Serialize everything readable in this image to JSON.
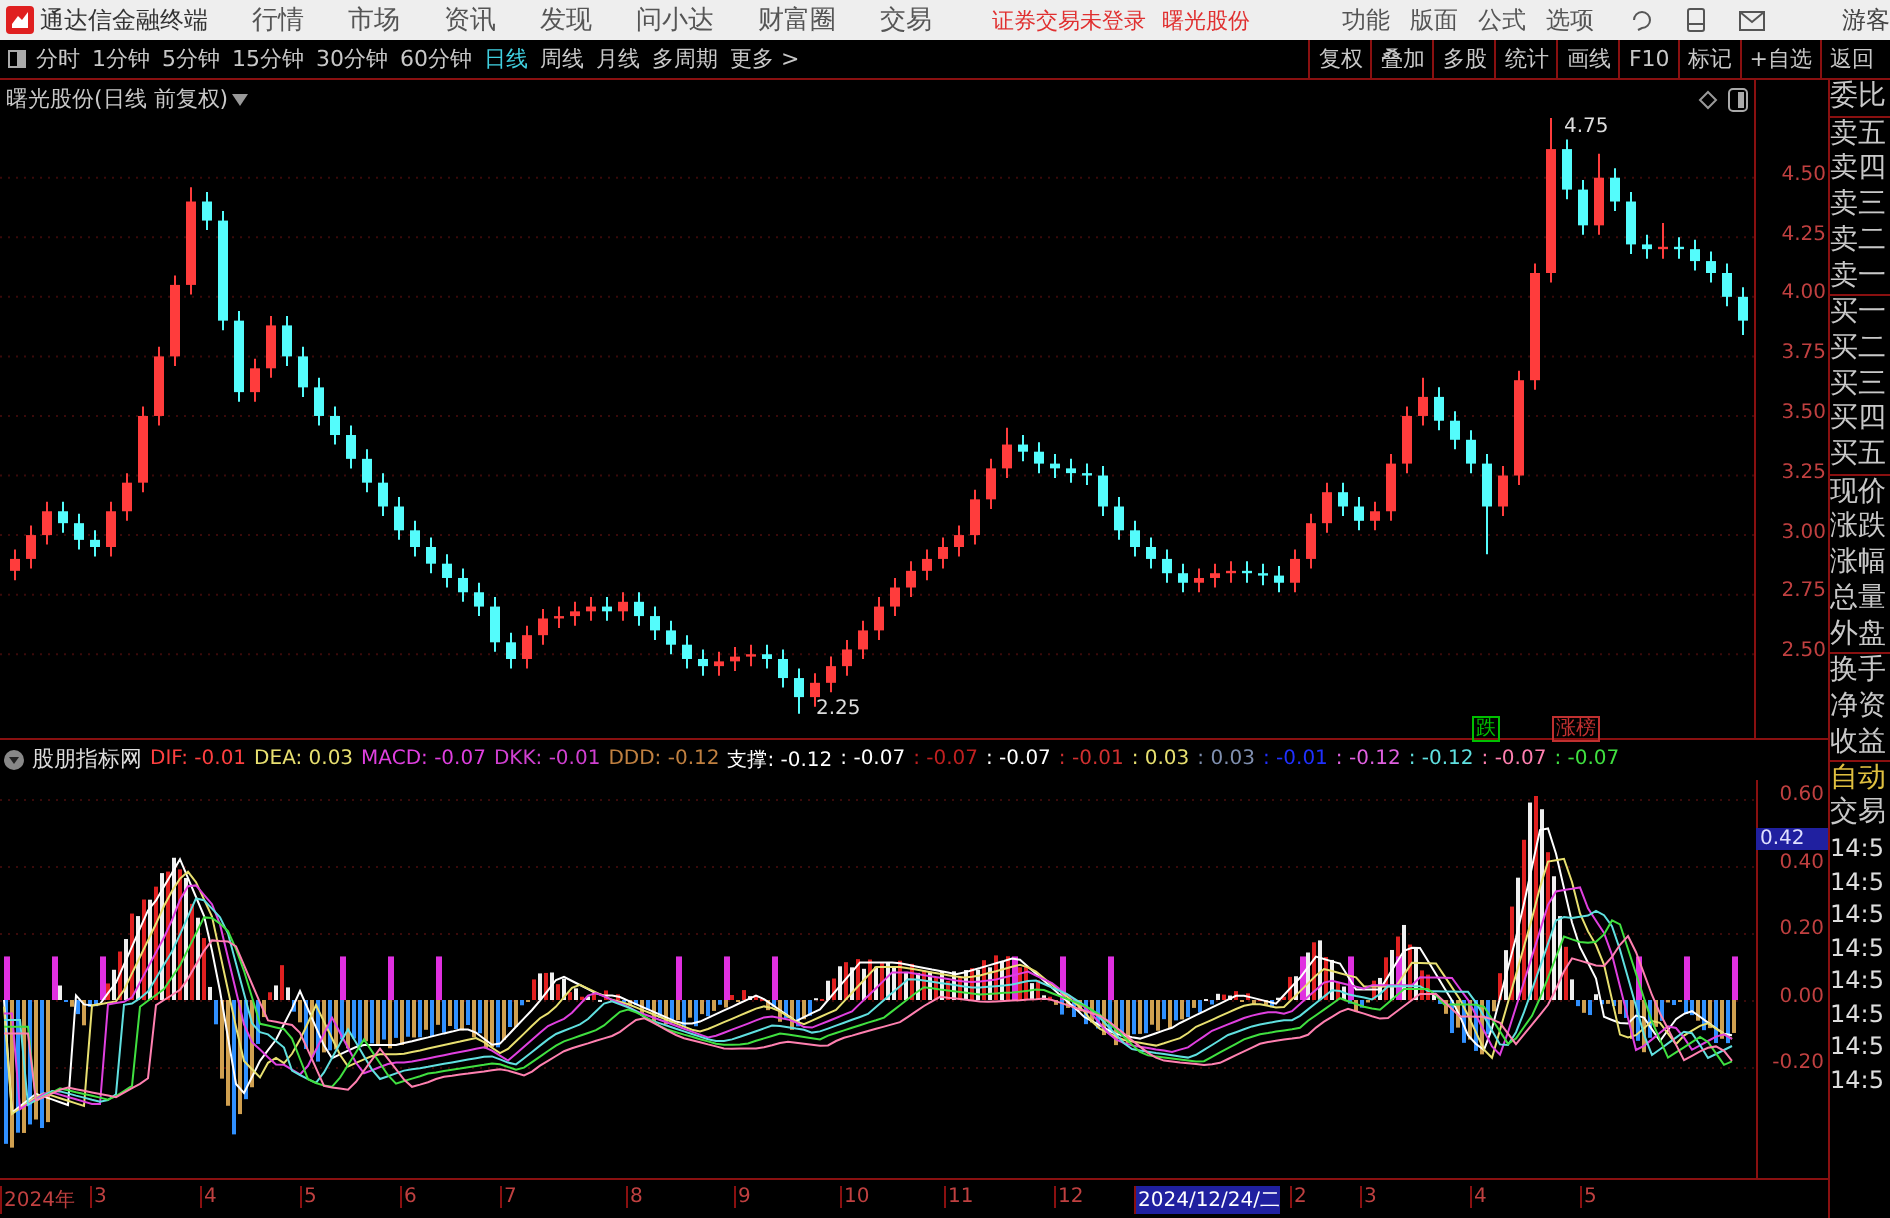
{
  "app": {
    "title": "通达信金融终端",
    "menus": [
      "行情",
      "市场",
      "资讯",
      "发现",
      "问小达",
      "财富圈",
      "交易"
    ],
    "notices": [
      "证券交易未登录",
      "曙光股份"
    ],
    "right_menus": [
      "功能",
      "版面",
      "公式",
      "选项"
    ],
    "user": "游客"
  },
  "periods": [
    {
      "label": "分时",
      "selected": false
    },
    {
      "label": "1分钟",
      "selected": false
    },
    {
      "label": "5分钟",
      "selected": false
    },
    {
      "label": "15分钟",
      "selected": false
    },
    {
      "label": "30分钟",
      "selected": false
    },
    {
      "label": "60分钟",
      "selected": false
    },
    {
      "label": "日线",
      "selected": true
    },
    {
      "label": "周线",
      "selected": false
    },
    {
      "label": "月线",
      "selected": false
    },
    {
      "label": "多周期",
      "selected": false
    },
    {
      "label": "更多 >",
      "selected": false
    }
  ],
  "tools": [
    "复权",
    "叠加",
    "多股",
    "统计",
    "画线",
    "F10",
    "标记",
    "+自选",
    "返回"
  ],
  "price_chart": {
    "title": "曙光股份(日线 前复权)",
    "high_label": "4.75",
    "low_label": "2.25",
    "badges": [
      {
        "text": "跌",
        "color": "#00c000"
      },
      {
        "text": "涨榜",
        "color": "#c03030"
      }
    ],
    "chart_data": {
      "type": "candlestick",
      "ylim": [
        2.14,
        4.91
      ],
      "grid": true,
      "yticks": [
        {
          "value": 4.5,
          "label": "4.50"
        },
        {
          "value": 4.25,
          "label": "4.25"
        },
        {
          "value": 4.0,
          "label": "4.00"
        },
        {
          "value": 3.75,
          "label": "3.75"
        },
        {
          "value": 3.5,
          "label": "3.50"
        },
        {
          "value": 3.25,
          "label": "3.25"
        },
        {
          "value": 3.0,
          "label": "3.00"
        },
        {
          "value": 2.75,
          "label": "2.75"
        },
        {
          "value": 2.5,
          "label": "2.50"
        }
      ],
      "ohlc": [
        [
          2.85,
          2.94,
          2.81,
          2.9
        ],
        [
          2.9,
          3.04,
          2.86,
          3.0
        ],
        [
          3.0,
          3.14,
          2.96,
          3.1
        ],
        [
          3.1,
          3.14,
          3.01,
          3.05
        ],
        [
          3.05,
          3.09,
          2.94,
          2.98
        ],
        [
          2.98,
          3.02,
          2.91,
          2.95
        ],
        [
          2.95,
          3.14,
          2.91,
          3.1
        ],
        [
          3.1,
          3.26,
          3.06,
          3.22
        ],
        [
          3.22,
          3.54,
          3.18,
          3.5
        ],
        [
          3.5,
          3.79,
          3.46,
          3.75
        ],
        [
          3.75,
          4.09,
          3.71,
          4.05
        ],
        [
          4.05,
          4.46,
          4.01,
          4.4
        ],
        [
          4.4,
          4.44,
          4.28,
          4.32
        ],
        [
          4.32,
          4.36,
          3.86,
          3.9
        ],
        [
          3.9,
          3.94,
          3.56,
          3.6
        ],
        [
          3.6,
          3.74,
          3.56,
          3.7
        ],
        [
          3.7,
          3.92,
          3.66,
          3.88
        ],
        [
          3.88,
          3.92,
          3.71,
          3.75
        ],
        [
          3.75,
          3.79,
          3.58,
          3.62
        ],
        [
          3.62,
          3.66,
          3.46,
          3.5
        ],
        [
          3.5,
          3.54,
          3.38,
          3.42
        ],
        [
          3.42,
          3.46,
          3.28,
          3.32
        ],
        [
          3.32,
          3.36,
          3.18,
          3.22
        ],
        [
          3.22,
          3.26,
          3.08,
          3.12
        ],
        [
          3.12,
          3.16,
          2.98,
          3.02
        ],
        [
          3.02,
          3.06,
          2.91,
          2.95
        ],
        [
          2.95,
          2.99,
          2.84,
          2.88
        ],
        [
          2.88,
          2.92,
          2.78,
          2.82
        ],
        [
          2.82,
          2.86,
          2.72,
          2.76
        ],
        [
          2.76,
          2.8,
          2.66,
          2.7
        ],
        [
          2.7,
          2.74,
          2.51,
          2.55
        ],
        [
          2.55,
          2.59,
          2.44,
          2.48
        ],
        [
          2.48,
          2.62,
          2.44,
          2.58
        ],
        [
          2.58,
          2.69,
          2.54,
          2.65
        ],
        [
          2.65,
          2.7,
          2.61,
          2.66
        ],
        [
          2.66,
          2.72,
          2.62,
          2.68
        ],
        [
          2.68,
          2.74,
          2.64,
          2.7
        ],
        [
          2.7,
          2.74,
          2.64,
          2.68
        ],
        [
          2.68,
          2.76,
          2.64,
          2.72
        ],
        [
          2.72,
          2.76,
          2.62,
          2.66
        ],
        [
          2.66,
          2.7,
          2.56,
          2.6
        ],
        [
          2.6,
          2.64,
          2.5,
          2.54
        ],
        [
          2.54,
          2.58,
          2.44,
          2.48
        ],
        [
          2.48,
          2.52,
          2.41,
          2.45
        ],
        [
          2.45,
          2.51,
          2.41,
          2.47
        ],
        [
          2.47,
          2.53,
          2.43,
          2.49
        ],
        [
          2.49,
          2.54,
          2.45,
          2.5
        ],
        [
          2.5,
          2.54,
          2.44,
          2.48
        ],
        [
          2.48,
          2.52,
          2.36,
          2.4
        ],
        [
          2.4,
          2.44,
          2.25,
          2.32
        ],
        [
          2.32,
          2.42,
          2.28,
          2.38
        ],
        [
          2.38,
          2.49,
          2.34,
          2.45
        ],
        [
          2.45,
          2.56,
          2.41,
          2.52
        ],
        [
          2.52,
          2.64,
          2.48,
          2.6
        ],
        [
          2.6,
          2.74,
          2.56,
          2.7
        ],
        [
          2.7,
          2.82,
          2.66,
          2.78
        ],
        [
          2.78,
          2.89,
          2.74,
          2.85
        ],
        [
          2.85,
          2.94,
          2.81,
          2.9
        ],
        [
          2.9,
          2.99,
          2.86,
          2.95
        ],
        [
          2.95,
          3.04,
          2.91,
          3.0
        ],
        [
          3.0,
          3.19,
          2.96,
          3.15
        ],
        [
          3.15,
          3.32,
          3.11,
          3.28
        ],
        [
          3.28,
          3.45,
          3.24,
          3.38
        ],
        [
          3.38,
          3.42,
          3.31,
          3.35
        ],
        [
          3.35,
          3.39,
          3.26,
          3.3
        ],
        [
          3.3,
          3.34,
          3.24,
          3.28
        ],
        [
          3.28,
          3.32,
          3.22,
          3.26
        ],
        [
          3.26,
          3.3,
          3.21,
          3.25
        ],
        [
          3.25,
          3.29,
          3.08,
          3.12
        ],
        [
          3.12,
          3.16,
          2.98,
          3.02
        ],
        [
          3.02,
          3.06,
          2.91,
          2.95
        ],
        [
          2.95,
          2.99,
          2.86,
          2.9
        ],
        [
          2.9,
          2.94,
          2.8,
          2.84
        ],
        [
          2.84,
          2.88,
          2.76,
          2.8
        ],
        [
          2.8,
          2.86,
          2.76,
          2.82
        ],
        [
          2.82,
          2.88,
          2.78,
          2.84
        ],
        [
          2.84,
          2.89,
          2.8,
          2.85
        ],
        [
          2.85,
          2.89,
          2.8,
          2.84
        ],
        [
          2.84,
          2.88,
          2.79,
          2.83
        ],
        [
          2.83,
          2.87,
          2.76,
          2.8
        ],
        [
          2.8,
          2.94,
          2.76,
          2.9
        ],
        [
          2.9,
          3.09,
          2.86,
          3.05
        ],
        [
          3.05,
          3.22,
          3.01,
          3.18
        ],
        [
          3.18,
          3.22,
          3.08,
          3.12
        ],
        [
          3.12,
          3.16,
          3.02,
          3.06
        ],
        [
          3.06,
          3.14,
          3.02,
          3.1
        ],
        [
          3.1,
          3.34,
          3.06,
          3.3
        ],
        [
          3.3,
          3.54,
          3.26,
          3.5
        ],
        [
          3.5,
          3.66,
          3.46,
          3.58
        ],
        [
          3.58,
          3.62,
          3.44,
          3.48
        ],
        [
          3.48,
          3.52,
          3.36,
          3.4
        ],
        [
          3.4,
          3.44,
          3.26,
          3.3
        ],
        [
          3.3,
          3.34,
          2.92,
          3.12
        ],
        [
          3.12,
          3.29,
          3.08,
          3.25
        ],
        [
          3.25,
          3.69,
          3.21,
          3.65
        ],
        [
          3.65,
          4.14,
          3.61,
          4.1
        ],
        [
          4.1,
          4.75,
          4.06,
          4.62
        ],
        [
          4.62,
          4.66,
          4.41,
          4.45
        ],
        [
          4.45,
          4.49,
          4.26,
          4.3
        ],
        [
          4.3,
          4.6,
          4.26,
          4.5
        ],
        [
          4.5,
          4.54,
          4.36,
          4.4
        ],
        [
          4.4,
          4.44,
          4.18,
          4.22
        ],
        [
          4.22,
          4.26,
          4.16,
          4.2
        ],
        [
          4.2,
          4.31,
          4.16,
          4.21
        ],
        [
          4.21,
          4.25,
          4.16,
          4.2
        ],
        [
          4.2,
          4.24,
          4.11,
          4.15
        ],
        [
          4.15,
          4.19,
          4.06,
          4.1
        ],
        [
          4.1,
          4.14,
          3.96,
          4.0
        ],
        [
          4.0,
          4.04,
          3.84,
          3.9
        ]
      ]
    }
  },
  "indicator": {
    "name": "股朋指标网",
    "values": [
      {
        "text": "DIF: -0.01",
        "color": "#ff4040"
      },
      {
        "text": "DEA: 0.03",
        "color": "#e8e070"
      },
      {
        "text": "MACD: -0.07",
        "color": "#e040e0"
      },
      {
        "text": "DKK: -0.01",
        "color": "#d040d0"
      },
      {
        "text": "DDD: -0.12",
        "color": "#c08040"
      },
      {
        "text": "支撑: -0.12",
        "color": "#ffffff"
      },
      {
        "text": ": -0.07",
        "color": "#ffffff"
      },
      {
        "text": ": -0.07",
        "color": "#c02020"
      },
      {
        "text": ": -0.07",
        "color": "#ffffff"
      },
      {
        "text": ": -0.01",
        "color": "#d03030"
      },
      {
        "text": ": 0.03",
        "color": "#e8e070"
      },
      {
        "text": ": 0.03",
        "color": "#8090b0"
      },
      {
        "text": ": -0.01",
        "color": "#2030ff"
      },
      {
        "text": ": -0.12",
        "color": "#e060e0"
      },
      {
        "text": ": -0.12",
        "color": "#60e0e0"
      },
      {
        "text": ": -0.07",
        "color": "#ff80b0"
      },
      {
        "text": ": -0.07",
        "color": "#40e040"
      }
    ],
    "yticks": [
      "0.60",
      "0.40",
      "0.20",
      "0.00",
      "-0.20"
    ],
    "cursor_value": "0.42"
  },
  "date_axis": [
    {
      "label": "2024年",
      "highlighted": false
    },
    {
      "label": "3",
      "highlighted": false
    },
    {
      "label": "4",
      "highlighted": false
    },
    {
      "label": "5",
      "highlighted": false
    },
    {
      "label": "6",
      "highlighted": false
    },
    {
      "label": "7",
      "highlighted": false
    },
    {
      "label": "8",
      "highlighted": false
    },
    {
      "label": "9",
      "highlighted": false
    },
    {
      "label": "10",
      "highlighted": false
    },
    {
      "label": "11",
      "highlighted": false
    },
    {
      "label": "12",
      "highlighted": false
    },
    {
      "label": "2024/12/24/二",
      "highlighted": true
    },
    {
      "label": "2",
      "highlighted": false
    },
    {
      "label": "3",
      "highlighted": false
    },
    {
      "label": "4",
      "highlighted": false
    },
    {
      "label": "5",
      "highlighted": false
    }
  ],
  "quote_panel": {
    "fields": [
      "委比",
      "卖五",
      "卖四",
      "卖三",
      "卖二",
      "卖一",
      "买一",
      "买二",
      "买三",
      "买四",
      "买五",
      "现价",
      "涨跌",
      "涨幅",
      "总量",
      "外盘",
      "换手",
      "净资",
      "收益"
    ],
    "mode": "自动",
    "trade_label": "交易",
    "times": [
      "14:5",
      "14:5",
      "14:5",
      "14:5",
      "14:5",
      "14:5",
      "14:5",
      "14:5"
    ]
  }
}
